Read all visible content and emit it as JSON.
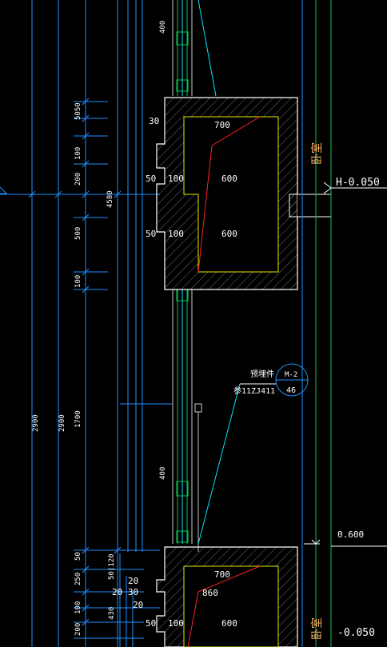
{
  "colors": {
    "background": "#000000",
    "dimension": "#1e90ff",
    "wall": "#ffffff",
    "yellow": "#e6e600",
    "red": "#ff2020",
    "green": "#00c853",
    "cyan": "#00e5ff",
    "grey": "#c8c8c8"
  },
  "dims_vertical": {
    "d_5050": "5050",
    "d_100a": "100",
    "d_200a": "200",
    "d_4580": "4580",
    "d_500": "500",
    "d_100b": "100",
    "d_2900a": "2900",
    "d_2900b": "2900",
    "d_1700": "1700",
    "d_400a": "400",
    "d_400b": "400",
    "d_50a": "50",
    "d_250": "250",
    "d_100c": "100",
    "d_200b": "200",
    "d_50_120": "50|120",
    "d_430": "430"
  },
  "dims_horizontal": {
    "d_700a": "700",
    "d_600a": "600",
    "d_600b": "600",
    "d_700b": "700",
    "d_860": "860",
    "d_600c": "600",
    "d_100a": "100",
    "d_100b": "100",
    "d_100c": "100",
    "d_30a": "30",
    "d_50a": "50",
    "d_50b": "50",
    "d_50c": "50",
    "d_20": "20",
    "d_20_30": "20 30",
    "d_20b": "20"
  },
  "labels": {
    "room_top": "卧室",
    "room_bottom": "卧室",
    "elev_h": "H-0.050",
    "elev_0600": "0.600",
    "elev_bottom": "-0.050",
    "embed_title": "预埋件",
    "embed_ref": "参11ZJ411",
    "detail_top": "M-2",
    "detail_bottom": "46"
  }
}
